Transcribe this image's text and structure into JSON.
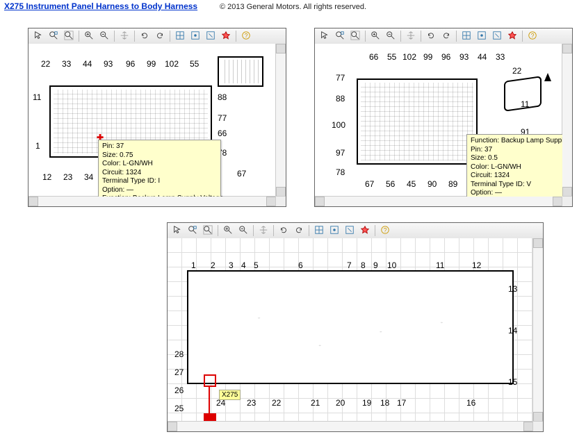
{
  "header": {
    "title_link": "X275 Instrument Panel Harness to Body Harness",
    "copyright": "© 2013 General Motors. All rights reserved."
  },
  "toolbar_icons": [
    "pointer-icon",
    "zoom-area-icon",
    "zoom-fit-icon",
    "zoom-in-icon",
    "zoom-out-icon",
    "pan-icon",
    "rotate-ccw-icon",
    "rotate-cw-icon",
    "toggle-grid-icon",
    "toggle-layers-icon",
    "toggle-callouts-icon",
    "highlight-icon",
    "help-icon"
  ],
  "left_panel": {
    "callouts_top": [
      "22",
      "33",
      "44",
      "93",
      "96",
      "99",
      "102",
      "55"
    ],
    "callouts_left": [
      "11",
      "1"
    ],
    "callouts_bottom": [
      "12",
      "23",
      "34"
    ],
    "callouts_right": [
      "88",
      "77",
      "66",
      "78",
      "67"
    ],
    "tooltip": {
      "Pin": "37",
      "Size": "0.75",
      "Color": "L-GN/WH",
      "Circuit": "1324",
      "Terminal Type ID": "I",
      "Option": "—",
      "Function": "Backup Lamp Supply Voltage"
    }
  },
  "right_panel": {
    "callouts_top": [
      "66",
      "55",
      "102",
      "99",
      "96",
      "93",
      "44",
      "33"
    ],
    "callouts_left": [
      "77",
      "88",
      "100",
      "97",
      "78"
    ],
    "callouts_bottom": [
      "67",
      "56",
      "45",
      "90",
      "89"
    ],
    "callouts_right": [
      "22",
      "11",
      "91"
    ],
    "tooltip": {
      "Function": "Backup Lamp Supply Voltage",
      "Pin": "37",
      "Size": "0.5",
      "Color": "L-GN/WH",
      "Circuit": "1324",
      "Terminal Type ID": "V",
      "Option": "—"
    }
  },
  "bottom_panel": {
    "callouts_top": [
      "1",
      "2",
      "3",
      "4",
      "5",
      "6",
      "7",
      "8",
      "9",
      "10",
      "11",
      "12"
    ],
    "callouts_right": [
      "13",
      "14",
      "15"
    ],
    "callouts_bottom_right_to_left": [
      "16",
      "17",
      "18",
      "19",
      "20",
      "21",
      "22",
      "23"
    ],
    "callouts_left": [
      "28",
      "27",
      "26",
      "25"
    ],
    "callout_extra": "24",
    "marker_label": "X275"
  }
}
